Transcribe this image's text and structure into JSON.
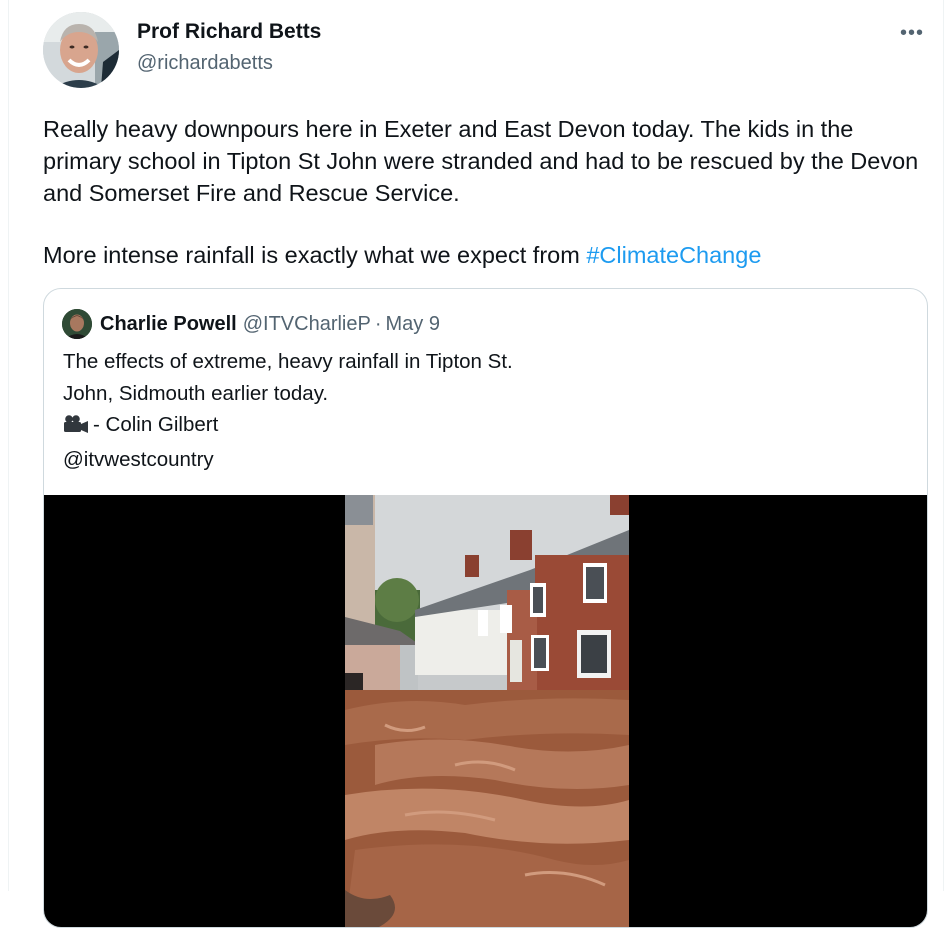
{
  "tweet": {
    "author": {
      "name": "Prof Richard Betts",
      "handle": "@richardabetts"
    },
    "more_label": "•••",
    "text": {
      "paragraph1": "Really heavy downpours here in Exeter and East Devon today. The kids in the primary school in Tipton St John were stranded and had to be rescued by the Devon and Somerset Fire and Rescue Service.",
      "paragraph2_prefix": "More intense rainfall is exactly what we expect from ",
      "hashtag": "#ClimateChange"
    }
  },
  "quoted_tweet": {
    "author": {
      "name": "Charlie Powell",
      "handle": "@ITVCharlieP"
    },
    "separator": "·",
    "date": "May 9",
    "lines": [
      "The effects of extreme, heavy rainfall in Tipton St.",
      "John, Sidmouth earlier today.",
      "- Colin Gilbert",
      "@itvwestcountry"
    ],
    "camera_icon": "movie-camera-icon",
    "media": {
      "type": "video",
      "description_icon": "flooded-street-video"
    }
  },
  "colors": {
    "link": "#1d9bf0",
    "secondary_text": "#536471",
    "primary_text": "#0f1419",
    "border": "#cfd9de"
  }
}
